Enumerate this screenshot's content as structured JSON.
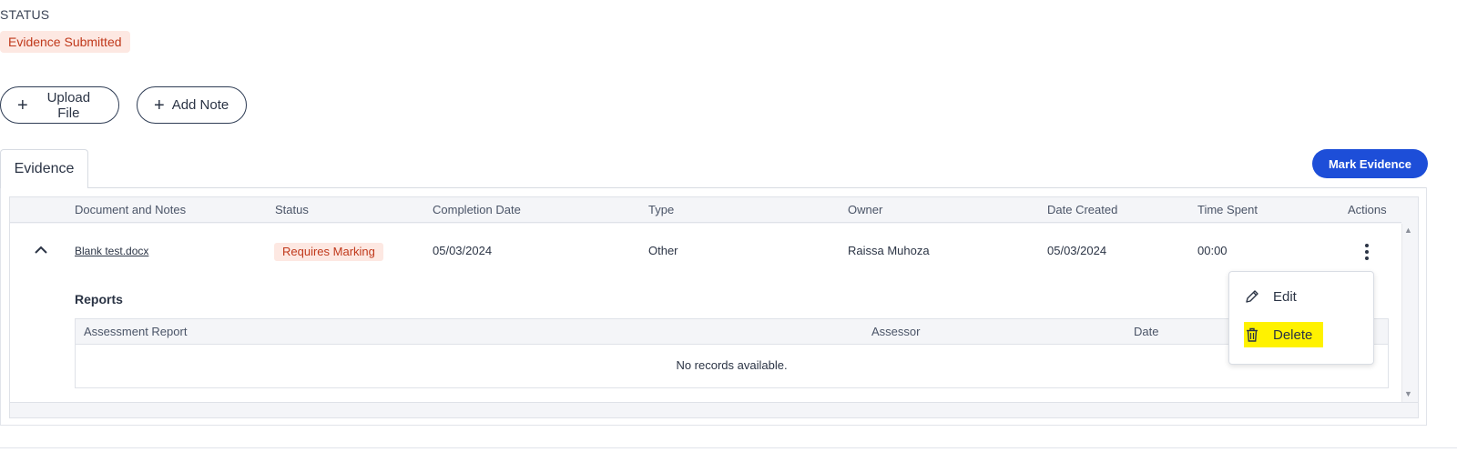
{
  "status": {
    "label": "STATUS",
    "badge": "Evidence Submitted"
  },
  "actions": {
    "upload_label": "Upload File",
    "note_label": "Add Note",
    "plus": "+"
  },
  "tabs": [
    {
      "label": "Evidence",
      "active": true
    }
  ],
  "mark_evidence_label": "Mark Evidence",
  "grid": {
    "columns": [
      "Document and Notes",
      "Status",
      "Completion Date",
      "Type",
      "Owner",
      "Date Created",
      "Time Spent",
      "Actions"
    ],
    "rows": [
      {
        "document": "Blank test.docx",
        "status": "Requires Marking",
        "completion_date": "05/03/2024",
        "type": "Other",
        "owner": "Raissa Muhoza",
        "date_created": "05/03/2024",
        "time_spent": "00:00"
      }
    ]
  },
  "reports": {
    "title": "Reports",
    "columns": [
      "Assessment Report",
      "Assessor",
      "Date"
    ],
    "empty_text": "No records available."
  },
  "context_menu": {
    "items": [
      {
        "label": "Edit",
        "icon": "pencil-icon"
      },
      {
        "label": "Delete",
        "icon": "trash-icon",
        "highlight": "#fff200"
      }
    ]
  },
  "colors": {
    "accent": "#1d4ed8",
    "badge_bg": "#fde8e2",
    "badge_text": "#c0391b",
    "text": "#2b3445"
  }
}
